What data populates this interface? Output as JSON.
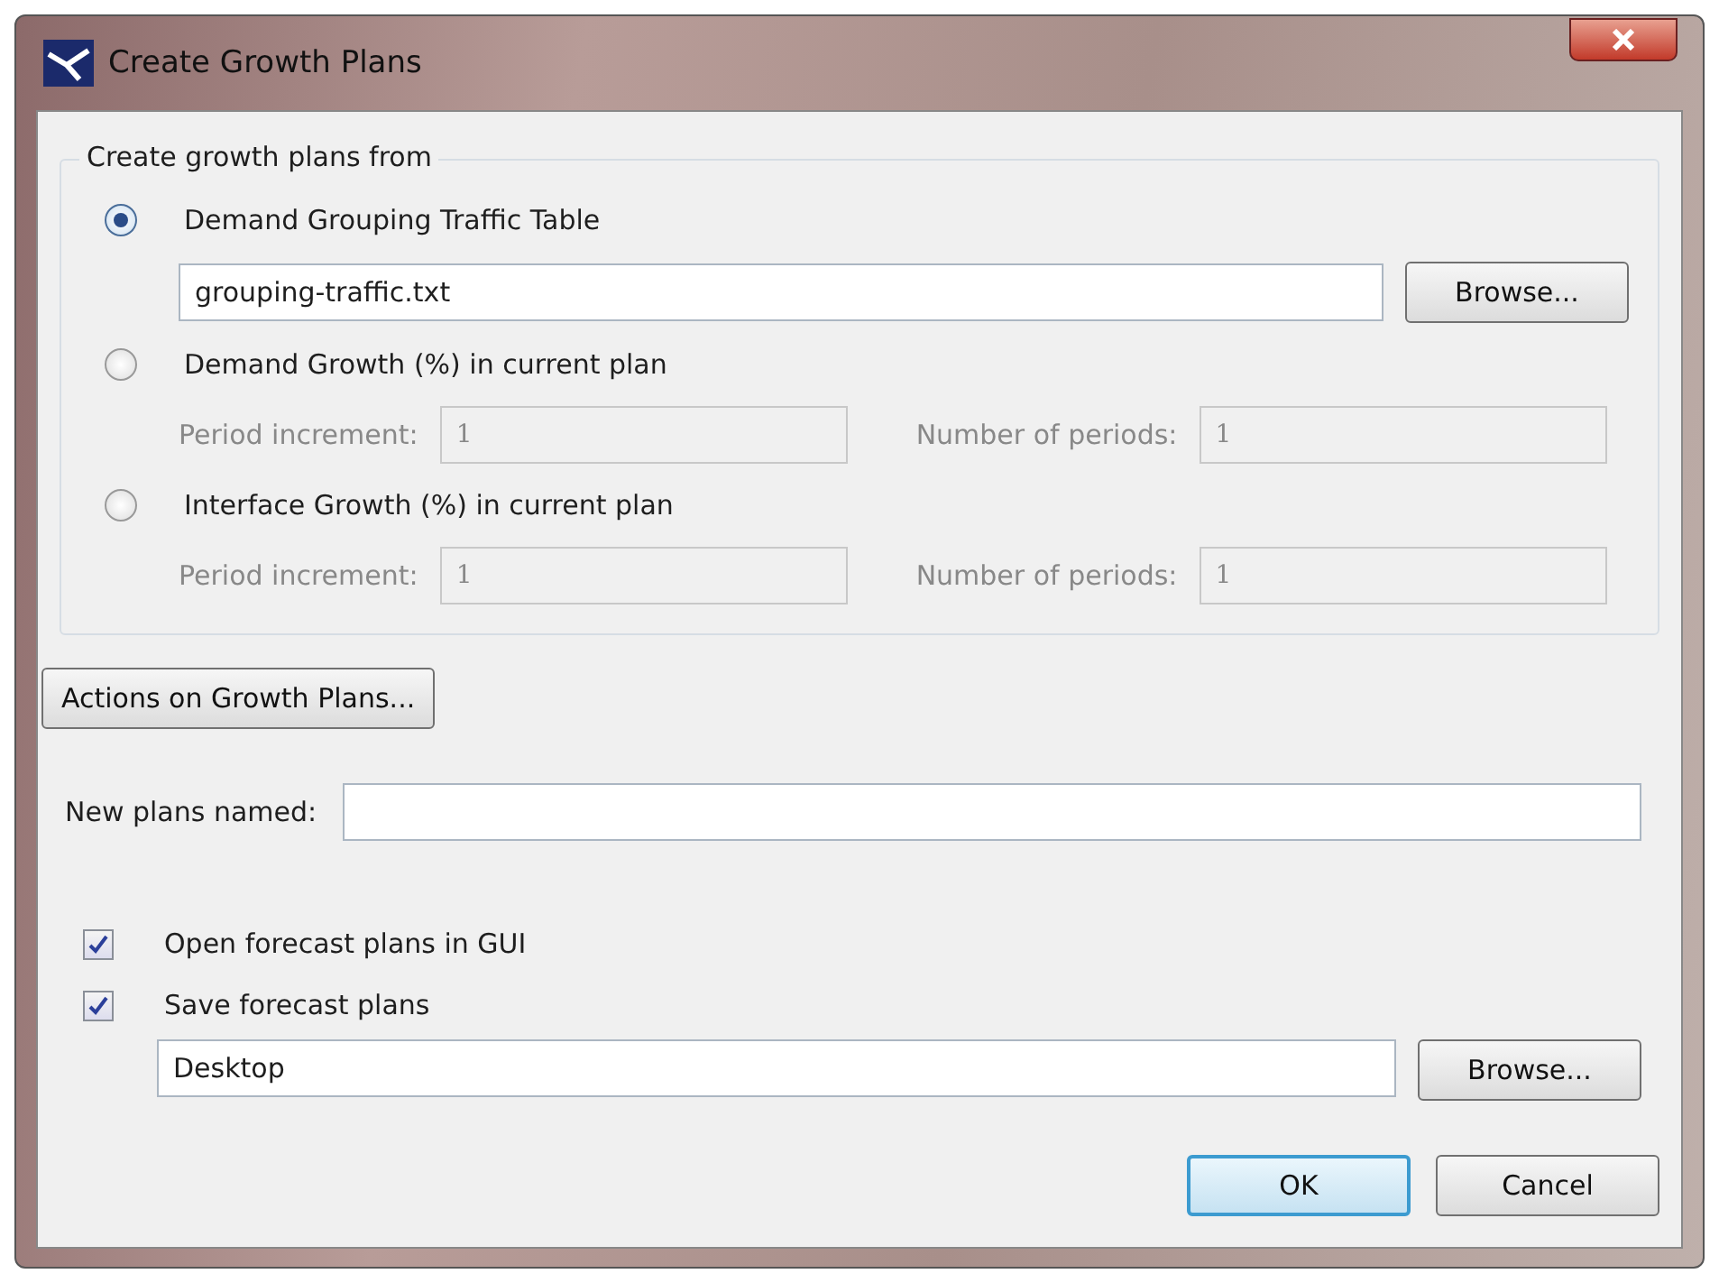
{
  "window": {
    "title": "Create Growth Plans"
  },
  "source_group": {
    "title": "Create growth plans from",
    "options": [
      {
        "kind": "file",
        "label": "Demand Grouping Traffic Table",
        "selected": true,
        "file": {
          "value": "grouping-traffic.txt",
          "browse": "Browse..."
        }
      },
      {
        "kind": "periods",
        "label": "Demand Growth (%) in current plan",
        "selected": false,
        "disabled": true,
        "fields": [
          {
            "label": "Period increment:",
            "value": "1"
          },
          {
            "label": "Number of periods:",
            "value": "1"
          }
        ]
      },
      {
        "kind": "periods",
        "label": "Interface Growth (%) in current plan",
        "selected": false,
        "disabled": true,
        "fields": [
          {
            "label": "Period increment:",
            "value": "1"
          },
          {
            "label": "Number of periods:",
            "value": "1"
          }
        ]
      }
    ]
  },
  "actions_button": "Actions on Growth Plans...",
  "new_plans": {
    "label": "New plans named:"
  },
  "checkboxes": [
    {
      "label": "Open forecast plans in GUI",
      "checked": true
    },
    {
      "label": "Save forecast plans",
      "checked": true
    }
  ],
  "save_path": {
    "value": "Desktop",
    "browse": "Browse..."
  },
  "buttons": [
    {
      "label": "OK",
      "default": true
    },
    {
      "label": "Cancel",
      "default": false
    }
  ]
}
